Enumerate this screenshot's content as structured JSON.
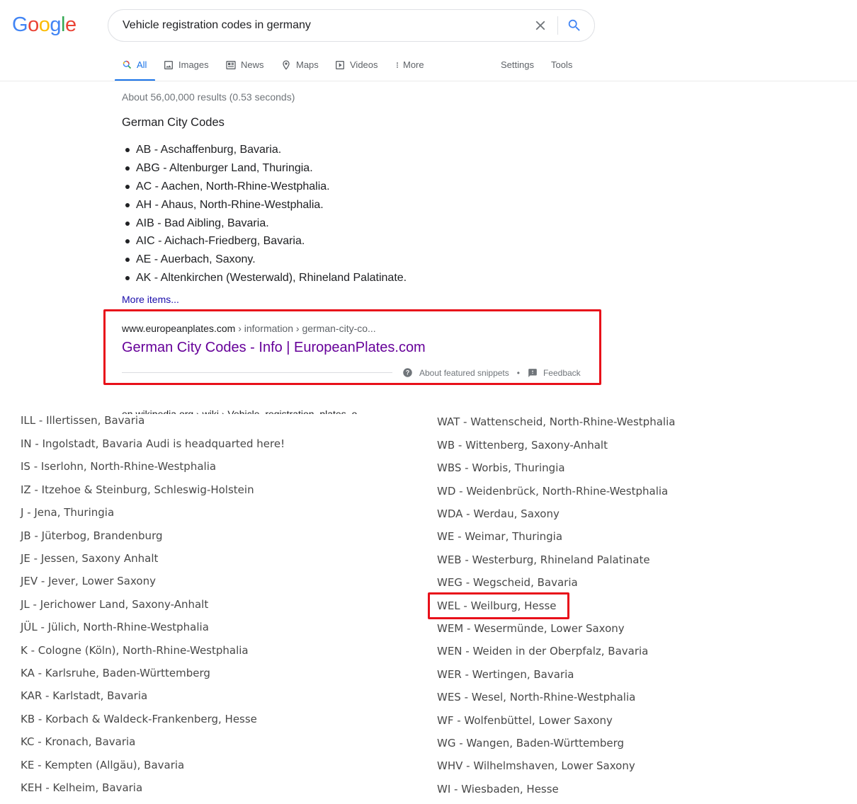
{
  "logo": "Google",
  "search": {
    "query": "Vehicle registration codes in germany"
  },
  "tabs": [
    {
      "label": "All",
      "icon": "search-icon",
      "active": true
    },
    {
      "label": "Images",
      "icon": "image-icon"
    },
    {
      "label": "News",
      "icon": "news-icon"
    },
    {
      "label": "Maps",
      "icon": "map-pin-icon"
    },
    {
      "label": "Videos",
      "icon": "video-icon"
    },
    {
      "label": "More",
      "icon": "more-vert-icon"
    },
    {
      "label": "Settings"
    },
    {
      "label": "Tools"
    }
  ],
  "stats": "About 56,00,000 results (0.53 seconds)",
  "featured_snippet": {
    "title": "German City Codes",
    "items": [
      "AB - Aschaffenburg, Bavaria.",
      "ABG - Altenburger Land, Thuringia.",
      "AC - Aachen, North-Rhine-Westphalia.",
      "AH - Ahaus, North-Rhine-Westphalia.",
      "AIB - Bad Aibling, Bavaria.",
      "AIC - Aichach-Friedberg, Bavaria.",
      "AE - Auerbach, Saxony.",
      "AK - Altenkirchen (Westerwald), Rhineland Palatinate."
    ],
    "more_items": "More items...",
    "cite_domain": "www.europeanplates.com",
    "cite_path": " › information › german-city-co...",
    "link_title": "German City Codes - Info | EuropeanPlates.com",
    "about": "About featured snippets",
    "separator": "•",
    "feedback": "Feedback"
  },
  "next_result_cut": "en.wikipedia.org › wiki › Vehicle_registration_plates_o...",
  "codes_left": [
    "ILL - Illertissen, Bavaria",
    "IN - Ingolstadt, Bavaria Audi is headquarted here!",
    "IS - Iserlohn, North-Rhine-Westphalia",
    "IZ - Itzehoe & Steinburg, Schleswig-Holstein",
    "J - Jena, Thuringia",
    "JB - Jüterbog, Brandenburg",
    "JE - Jessen, Saxony Anhalt",
    "JEV - Jever, Lower Saxony",
    "JL - Jerichower Land, Saxony-Anhalt",
    "JÜL - Jülich, North-Rhine-Westphalia",
    "K - Cologne (Köln), North-Rhine-Westphalia",
    "KA - Karlsruhe, Baden-Württemberg",
    "KAR - Karlstadt, Bavaria",
    "KB - Korbach & Waldeck-Frankenberg, Hesse",
    "KC - Kronach, Bavaria",
    "KE - Kempten (Allgäu), Bavaria",
    "KEH - Kelheim, Bavaria"
  ],
  "codes_right": [
    "WAT - Wattenscheid, North-Rhine-Westphalia",
    "WB - Wittenberg, Saxony-Anhalt",
    "WBS - Worbis, Thuringia",
    "WD - Weidenbrück, North-Rhine-Westphalia",
    "WDA - Werdau, Saxony",
    "WE - Weimar, Thuringia",
    "WEB - Westerburg, Rhineland Palatinate",
    "WEG - Wegscheid, Bavaria",
    "WEL - Weilburg, Hesse",
    "WEM - Wesermünde, Lower Saxony",
    "WEN - Weiden in der Oberpfalz, Bavaria",
    "WER - Wertingen, Bavaria",
    "WES - Wesel, North-Rhine-Westphalia",
    "WF - Wolfenbüttel, Lower Saxony",
    "WG - Wangen, Baden-Württemberg",
    "WHV - Wilhelmshaven, Lower Saxony",
    "WI - Wiesbaden, Hesse"
  ],
  "colors": {
    "accent": "#1a73e8",
    "visited_link": "#660099",
    "highlight": "#e8101a"
  }
}
